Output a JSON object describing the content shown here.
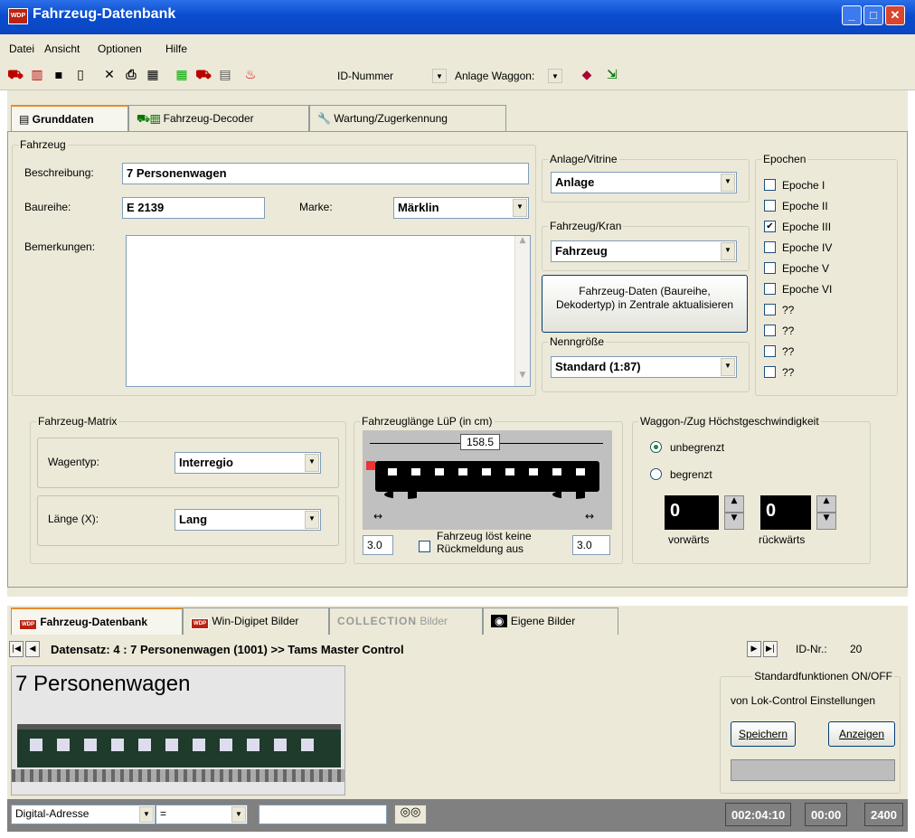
{
  "window": {
    "title": "Fahrzeug-Datenbank",
    "logo": "WDP"
  },
  "menu": [
    "Datei",
    "Ansicht",
    "Optionen",
    "Hilfe"
  ],
  "toolbar": {
    "id_combo": "ID-Nummer",
    "anlage_combo": "Anlage Waggon:"
  },
  "tabs": [
    {
      "label": "Grunddaten"
    },
    {
      "label": "Fahrzeug-Decoder"
    },
    {
      "label": "Wartung/Zugerkennung"
    }
  ],
  "fahrzeug": {
    "group_label": "Fahrzeug",
    "beschreibung_label": "Beschreibung:",
    "beschreibung_value": "7 Personenwagen",
    "baureihe_label": "Baureihe:",
    "baureihe_value": "E 2139",
    "marke_label": "Marke:",
    "marke_value": "Märklin",
    "bemerkungen_label": "Bemerkungen:"
  },
  "anlage": {
    "group_label": "Anlage/Vitrine",
    "value": "Anlage"
  },
  "kran": {
    "group_label": "Fahrzeug/Kran",
    "value": "Fahrzeug"
  },
  "update_button": "Fahrzeug-Daten (Baureihe, Dekodertyp) in Zentrale aktualisieren",
  "nenngroesse": {
    "group_label": "Nenngröße",
    "value": "Standard (1:87)"
  },
  "epochen": {
    "group_label": "Epochen",
    "items": [
      {
        "label": "Epoche I",
        "checked": false
      },
      {
        "label": "Epoche II",
        "checked": false
      },
      {
        "label": "Epoche III",
        "checked": true
      },
      {
        "label": "Epoche IV",
        "checked": false
      },
      {
        "label": "Epoche V",
        "checked": false
      },
      {
        "label": "Epoche VI",
        "checked": false
      },
      {
        "label": "??",
        "checked": false
      },
      {
        "label": "??",
        "checked": false
      },
      {
        "label": "??",
        "checked": false
      },
      {
        "label": "??",
        "checked": false
      }
    ]
  },
  "matrix": {
    "group_label": "Fahrzeug-Matrix",
    "wagentyp_label": "Wagentyp:",
    "wagentyp_value": "Interregio",
    "laenge_label": "Länge (X):",
    "laenge_value": "Lang"
  },
  "laenge": {
    "group_label": "Fahrzeuglänge LüP (in cm)",
    "total": "158.5",
    "left": "3.0",
    "right": "3.0",
    "checkbox_label": "Fahrzeug löst keine Rückmeldung aus"
  },
  "speed": {
    "group_label": "Waggon-/Zug Höchstgeschwindigkeit",
    "opt1": "unbegrenzt",
    "opt2": "begrenzt",
    "vorwaerts_value": "0",
    "vorwaerts_label": "vorwärts",
    "rueckwaerts_value": "0",
    "rueckwaerts_label": "rückwärts"
  },
  "bottom_tabs": [
    "Fahrzeug-Datenbank",
    "Win-Digipet Bilder",
    "COLLECTION",
    "Bilder",
    "Eigene Bilder"
  ],
  "nav": {
    "record": "Datensatz: 4 : 7 Personenwagen  (1001) >> Tams Master Control",
    "id_label": "ID-Nr.:",
    "id_value": "20"
  },
  "picture": {
    "caption": "7 Personenwagen"
  },
  "standard": {
    "group_label": "Standardfunktionen ON/OFF",
    "subtitle": "von Lok-Control Einstellungen",
    "save": "Speichern",
    "show": "Anzeigen"
  },
  "status": {
    "filter_field": "Digital-Adresse",
    "operator": "=",
    "time1": "002:04:10",
    "time2": "00:00",
    "count": "2400"
  }
}
